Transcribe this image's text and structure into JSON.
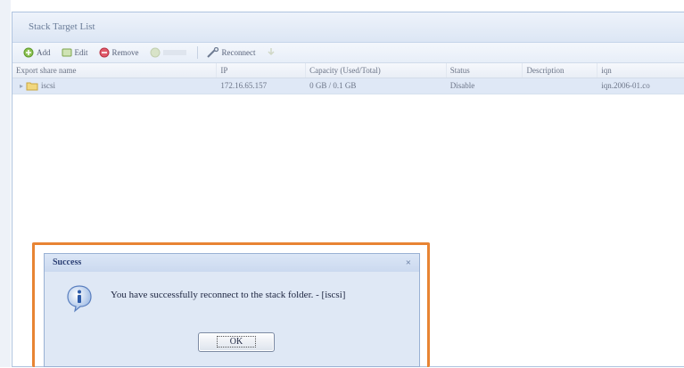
{
  "panel": {
    "title": "Stack Target List"
  },
  "toolbar": {
    "add": "Add",
    "edit": "Edit",
    "remove": "Remove",
    "disabled_btn": "",
    "reconnect": "Reconnect"
  },
  "grid": {
    "headers": [
      "Export share name",
      "IP",
      "Capacity (Used/Total)",
      "Status",
      "Description",
      "iqn"
    ],
    "rows": [
      {
        "name": "iscsi",
        "ip": "172.16.65.157",
        "capacity": "0 GB / 0.1 GB",
        "status": "Disable",
        "description": "",
        "iqn": "iqn.2006-01.co"
      }
    ]
  },
  "dialog": {
    "title": "Success",
    "close": "×",
    "message": "You have successfully reconnect to the stack folder. - [iscsi]",
    "ok_label": "OK"
  }
}
